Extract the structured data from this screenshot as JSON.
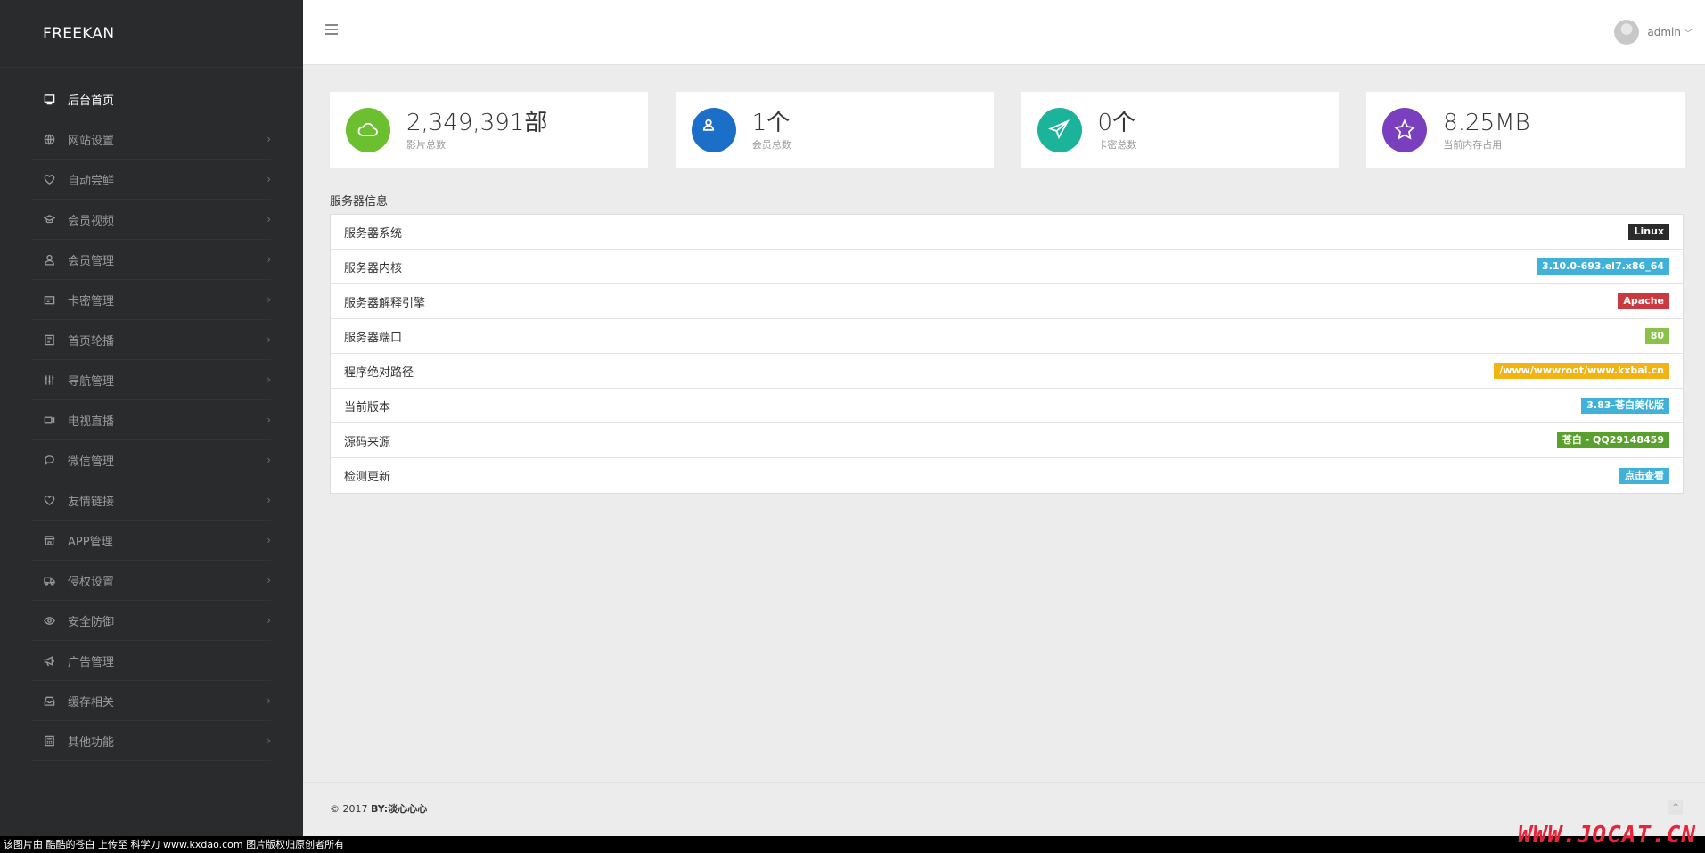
{
  "brand": "FREEKAN",
  "sidebar": {
    "items": [
      {
        "label": "后台首页",
        "icon": "monitor-icon",
        "active": true,
        "chevron": false
      },
      {
        "label": "网站设置",
        "icon": "globe-icon",
        "active": false,
        "chevron": true
      },
      {
        "label": "自动尝鲜",
        "icon": "heart-icon",
        "active": false,
        "chevron": true
      },
      {
        "label": "会员视频",
        "icon": "graduation-cap-icon",
        "active": false,
        "chevron": true
      },
      {
        "label": "会员管理",
        "icon": "user-icon",
        "active": false,
        "chevron": true
      },
      {
        "label": "卡密管理",
        "icon": "card-icon",
        "active": false,
        "chevron": true
      },
      {
        "label": "首页轮播",
        "icon": "document-icon",
        "active": false,
        "chevron": true
      },
      {
        "label": "导航管理",
        "icon": "sliders-icon",
        "active": false,
        "chevron": true
      },
      {
        "label": "电视直播",
        "icon": "video-icon",
        "active": false,
        "chevron": true
      },
      {
        "label": "微信管理",
        "icon": "chat-icon",
        "active": false,
        "chevron": true
      },
      {
        "label": "友情链接",
        "icon": "heart-icon",
        "active": false,
        "chevron": true
      },
      {
        "label": "APP管理",
        "icon": "store-icon",
        "active": false,
        "chevron": true
      },
      {
        "label": "侵权设置",
        "icon": "truck-icon",
        "active": false,
        "chevron": true
      },
      {
        "label": "安全防御",
        "icon": "eye-icon",
        "active": false,
        "chevron": true
      },
      {
        "label": "广告管理",
        "icon": "megaphone-icon",
        "active": false,
        "chevron": false
      },
      {
        "label": "缓存相关",
        "icon": "inbox-icon",
        "active": false,
        "chevron": true
      },
      {
        "label": "其他功能",
        "icon": "calculator-icon",
        "active": false,
        "chevron": true
      }
    ]
  },
  "header": {
    "user_name": "admin",
    "caret": "﹀"
  },
  "stats": [
    {
      "value": "2,349,391部",
      "label": "影片总数",
      "icon": "cloud-icon",
      "color": "#6cbf2e"
    },
    {
      "value": "1个",
      "label": "会员总数",
      "icon": "user-icon",
      "color": "#1c6fc9"
    },
    {
      "value": "0个",
      "label": "卡密总数",
      "icon": "paper-plane-icon",
      "color": "#1cb39b"
    },
    {
      "value": "8.25MB",
      "label": "当前内存占用",
      "icon": "star-icon",
      "color": "#7a3fbf"
    }
  ],
  "server": {
    "title": "服务器信息",
    "rows": [
      {
        "label": "服务器系统",
        "value": "Linux",
        "color": "#2b2b2b"
      },
      {
        "label": "服务器内核",
        "value": "3.10.0-693.el7.x86_64",
        "color": "#40b1d9"
      },
      {
        "label": "服务器解释引擎",
        "value": "Apache",
        "color": "#c9393f"
      },
      {
        "label": "服务器端口",
        "value": "80",
        "color": "#8cc24a"
      },
      {
        "label": "程序绝对路径",
        "value": "/www/wwwroot/www.kxbai.cn",
        "color": "#f2b415"
      },
      {
        "label": "当前版本",
        "value": "3.83-苍白美化版",
        "color": "#40b1d9"
      },
      {
        "label": "源码来源",
        "value": "苍白 - QQ29148459",
        "color": "#5aa02c"
      },
      {
        "label": "检测更新",
        "value": "点击查看",
        "color": "#40b1d9"
      }
    ]
  },
  "footer": {
    "copyright_prefix": "© 2017 ",
    "copyright_author": "BY:淡心心心",
    "back_top": "^"
  },
  "watermark": {
    "bar_text": "该图片由 酷酷的苍白 上传至 科学刀 www.kxdao.com 图片版权归原创者所有",
    "logo": "WWW.JOCAT.CN"
  }
}
